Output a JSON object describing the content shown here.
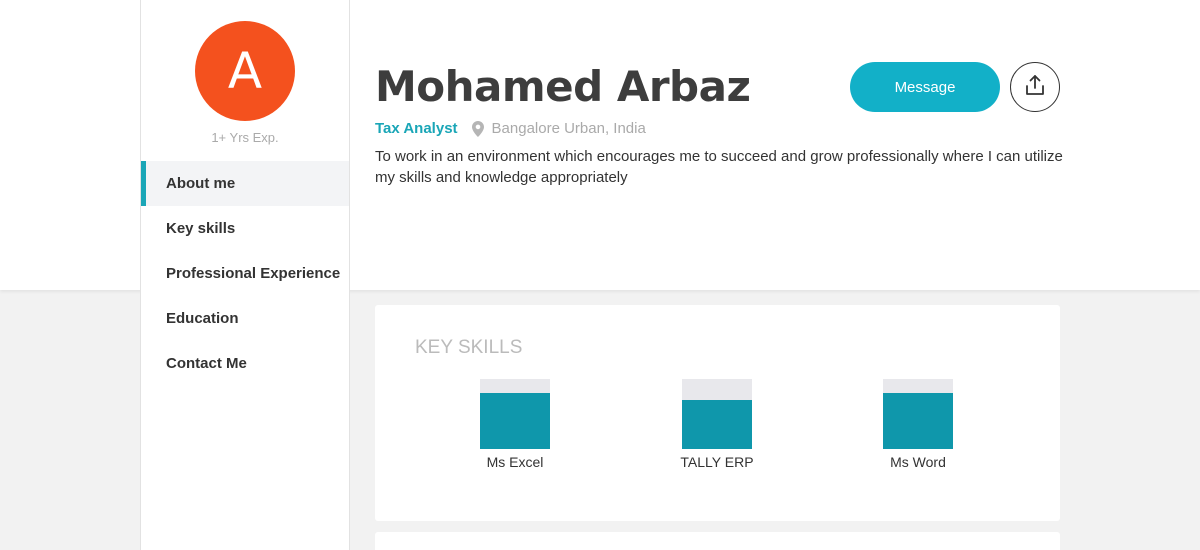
{
  "profile": {
    "avatar_letter": "A",
    "experience": "1+ Yrs Exp.",
    "name": "Mohamed Arbaz",
    "role": "Tax Analyst",
    "location": "Bangalore Urban, India",
    "summary": "To work in an environment which encourages me to succeed and grow professionally where I can utilize my skills and knowledge appropriately"
  },
  "nav": {
    "items": [
      {
        "label": "About me",
        "active": true
      },
      {
        "label": "Key skills"
      },
      {
        "label": "Professional Experience"
      },
      {
        "label": "Education"
      },
      {
        "label": "Contact Me"
      }
    ]
  },
  "actions": {
    "message_label": "Message",
    "share_icon": "share-upload-icon"
  },
  "skills": {
    "title": "KEY SKILLS",
    "items": [
      {
        "label": "Ms Excel",
        "level": 0.8
      },
      {
        "label": "TALLY ERP",
        "level": 0.7
      },
      {
        "label": "Ms Word",
        "level": 0.8
      }
    ]
  },
  "colors": {
    "accent": "#12b0c8",
    "avatar": "#f4511e",
    "bar": "#0f97ab"
  }
}
